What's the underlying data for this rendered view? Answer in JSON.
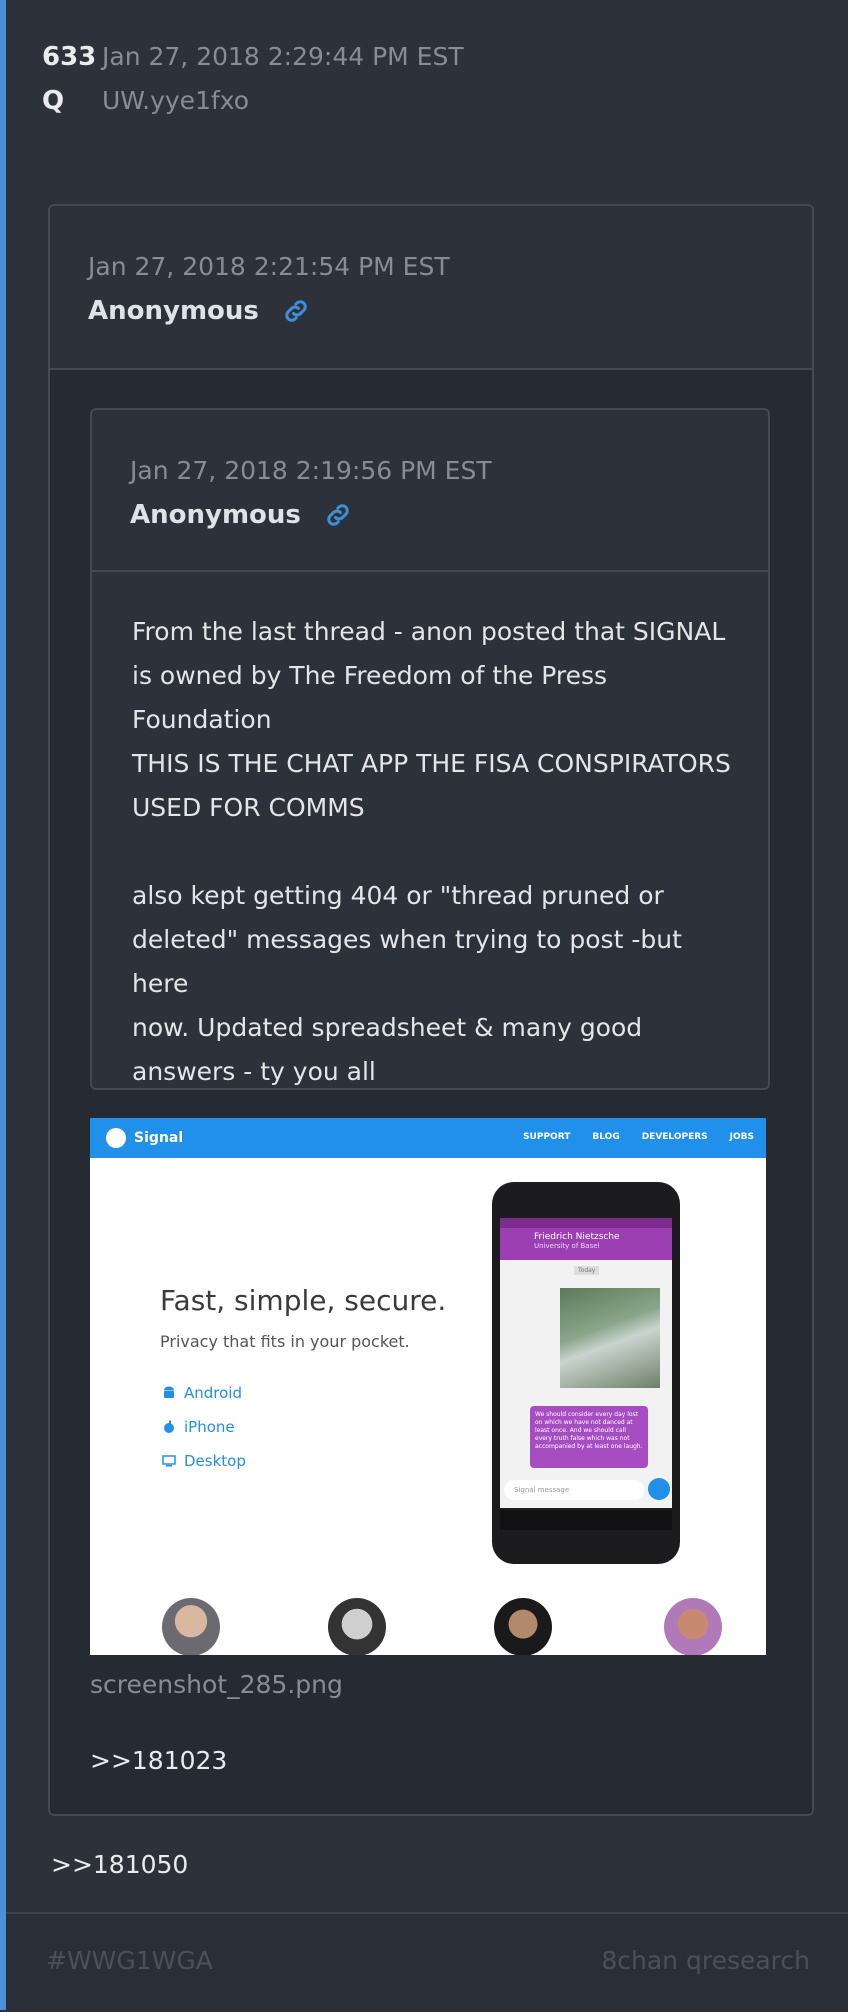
{
  "post": {
    "number": "633",
    "datetime": "Jan 27, 2018 2:29:44 PM EST",
    "q_label": "Q",
    "tripcode": "UW.yye1fxo"
  },
  "quote1": {
    "datetime": "Jan 27, 2018 2:21:54 PM EST",
    "author": "Anonymous"
  },
  "quote2": {
    "datetime": "Jan 27, 2018 2:19:56 PM EST",
    "author": "Anonymous",
    "lines": [
      "From the last thread - anon posted that SIGNAL",
      "is owned by The Freedom of the Press",
      "Foundation",
      "THIS IS THE CHAT APP THE FISA CONSPIRATORS",
      "USED FOR COMMS"
    ],
    "lines2": [
      "also kept getting 404 or \"thread pruned or",
      "deleted\" messages when trying to post -but here",
      "now. Updated spreadsheet & many good",
      "answers - ty you all"
    ]
  },
  "screenshot": {
    "brand": "Signal",
    "nav": [
      "SUPPORT",
      "BLOG",
      "DEVELOPERS",
      "JOBS"
    ],
    "headline": "Fast, simple, secure.",
    "subheadline": "Privacy that fits in your pocket.",
    "platforms": [
      "Android",
      "iPhone",
      "Desktop"
    ],
    "phone": {
      "contact": "Friedrich Nietzsche",
      "contact_sub": "University of Basel",
      "day_label": "Today",
      "message": "We should consider every day lost on which we have not danced at least once. And we should call every truth false which was not accompanied by at least one laugh.",
      "input_placeholder": "Signal message"
    },
    "filename": "screenshot_285.png"
  },
  "refs": {
    "inner": ">>181023",
    "outer": ">>181050"
  },
  "footer": {
    "hashtag": "#WWG1WGA",
    "source": "8chan qresearch"
  },
  "colors": {
    "accent_bar": "#4a8fd8",
    "link_icon": "#3d8fd6",
    "signal_blue": "#2090ea"
  }
}
